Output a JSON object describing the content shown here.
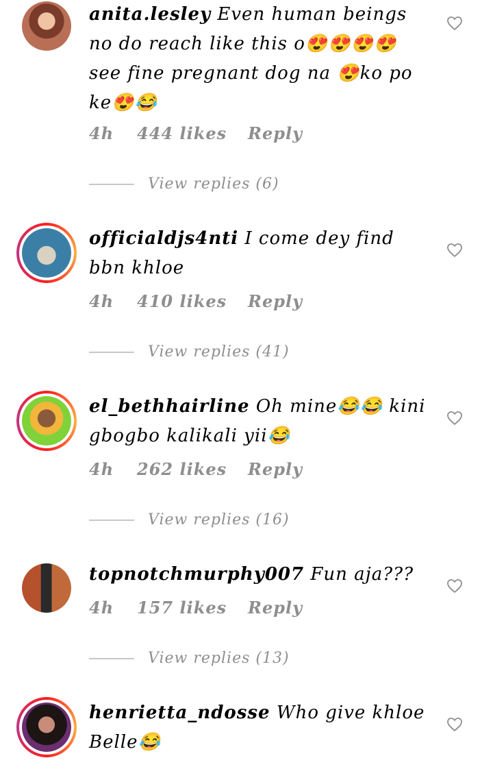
{
  "comments": [
    {
      "username": "anita.lesley",
      "text": "Even human beings no do reach like this o😍😍😍😍 see fine pregnant dog na 😍ko po ke😍😂",
      "time": "4h",
      "likes": "444 likes",
      "reply": "Reply",
      "view_replies": "View replies (6)",
      "has_story": false
    },
    {
      "username": "officialdjs4nti",
      "text": "I come dey find bbn khloe",
      "time": "4h",
      "likes": "410 likes",
      "reply": "Reply",
      "view_replies": "View replies (41)",
      "has_story": true
    },
    {
      "username": "el_bethhairline",
      "text": "Oh mine😂😂 kini gbogbo kalikali yii😂",
      "time": "4h",
      "likes": "262 likes",
      "reply": "Reply",
      "view_replies": "View replies (16)",
      "has_story": true
    },
    {
      "username": "topnotchmurphy007",
      "text": "Fun aja???",
      "time": "4h",
      "likes": "157 likes",
      "reply": "Reply",
      "view_replies": "View replies (13)",
      "has_story": false
    },
    {
      "username": "henrietta_ndosse",
      "text": "Who give khloe Belle😂",
      "has_story": true
    }
  ],
  "icons": {
    "like": "heart-outline-icon"
  },
  "colors": {
    "meta_text": "#8e8e8e",
    "story_ring_start": "#fd1d1d",
    "story_ring_end": "#fcb045"
  }
}
